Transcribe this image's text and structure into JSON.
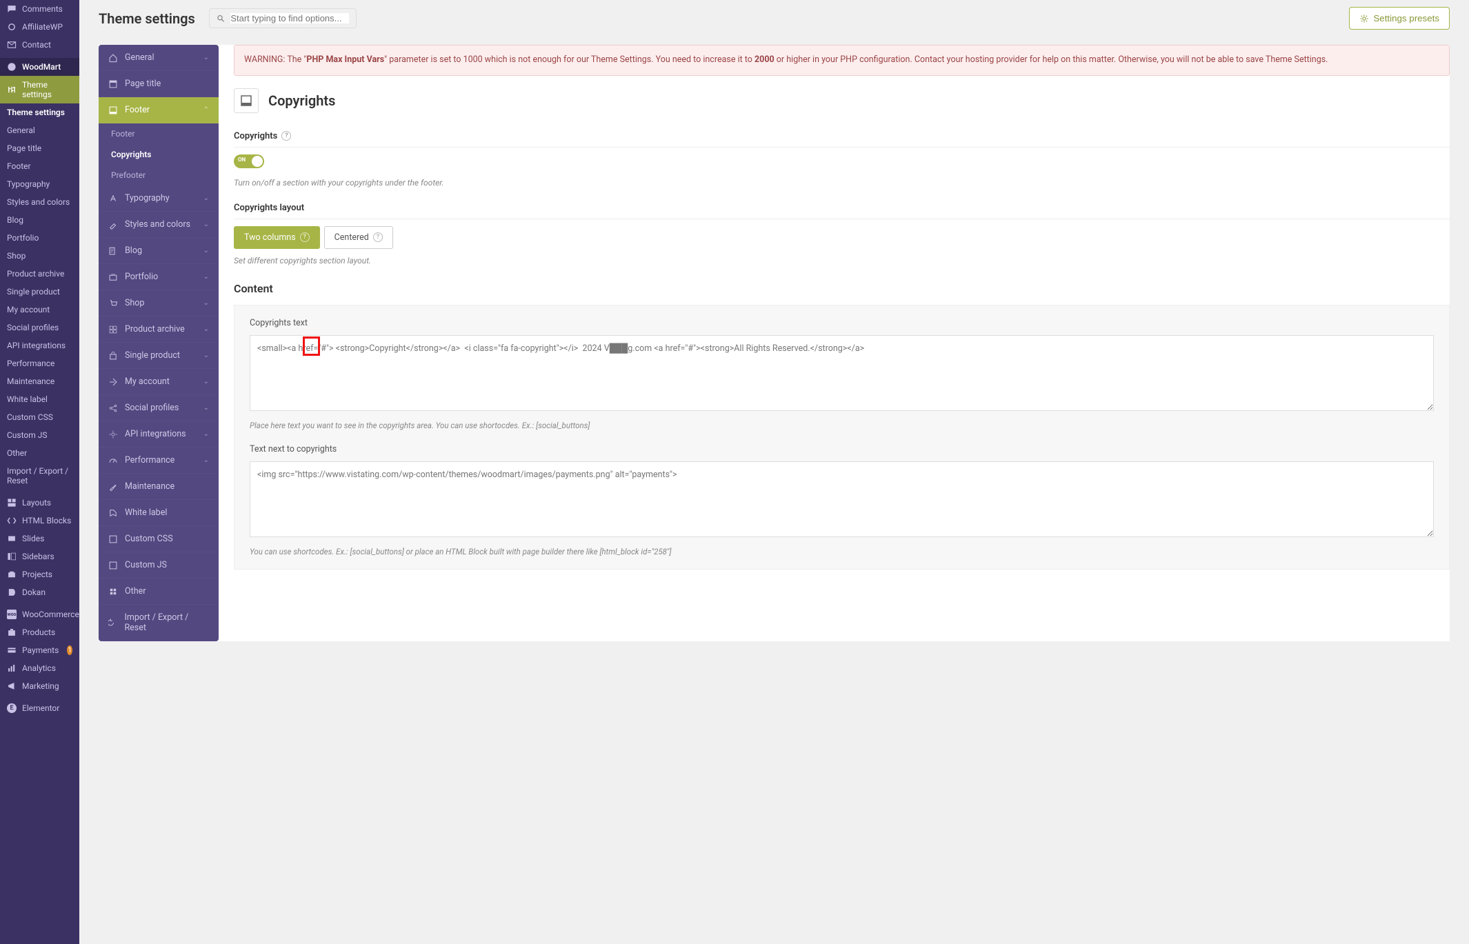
{
  "header": {
    "title": "Theme settings",
    "search_placeholder": "Start typing to find options...",
    "presets_label": "Settings presets"
  },
  "wp_menu": {
    "comments": "Comments",
    "affiliate": "AffiliateWP",
    "contact": "Contact",
    "woodmart": "WoodMart",
    "theme_settings": "Theme settings",
    "subs": {
      "theme_settings": "Theme settings",
      "general": "General",
      "page_title": "Page title",
      "footer": "Footer",
      "typography": "Typography",
      "styles_colors": "Styles and colors",
      "blog": "Blog",
      "portfolio": "Portfolio",
      "shop": "Shop",
      "product_archive": "Product archive",
      "single_product": "Single product",
      "my_account": "My account",
      "social_profiles": "Social profiles",
      "api_integrations": "API integrations",
      "performance": "Performance",
      "maintenance": "Maintenance",
      "white_label": "White label",
      "custom_css": "Custom CSS",
      "custom_js": "Custom JS",
      "other": "Other",
      "import_export": "Import / Export / Reset"
    },
    "layouts": "Layouts",
    "html_blocks": "HTML Blocks",
    "slides": "Slides",
    "sidebars": "Sidebars",
    "projects": "Projects",
    "dokan": "Dokan",
    "woo": "WooCommerce",
    "products": "Products",
    "payments": "Payments",
    "payments_badge": "1",
    "analytics": "Analytics",
    "marketing": "Marketing",
    "elementor": "Elementor"
  },
  "settings_nav": {
    "general": "General",
    "page_title": "Page title",
    "footer": "Footer",
    "footer_sub": "Footer",
    "copyrights_sub": "Copyrights",
    "prefooter_sub": "Prefooter",
    "typography": "Typography",
    "styles_colors": "Styles and colors",
    "blog": "Blog",
    "portfolio": "Portfolio",
    "shop": "Shop",
    "product_archive": "Product archive",
    "single_product": "Single product",
    "my_account": "My account",
    "social_profiles": "Social profiles",
    "api_integrations": "API integrations",
    "performance": "Performance",
    "maintenance": "Maintenance",
    "white_label": "White label",
    "custom_css": "Custom CSS",
    "custom_js": "Custom JS",
    "other": "Other",
    "import_export": "Import / Export / Reset"
  },
  "warning": {
    "prefix": "WARNING: The \"",
    "var": "PHP Max Input Vars",
    "mid": "\" parameter is set to 1000 which is not enough for our Theme Settings. You need to increase it to ",
    "num": "2000",
    "suffix": " or higher in your PHP configuration. Contact your hosting provider for help on this matter. Otherwise, you will not be able to save Theme Settings."
  },
  "panel": {
    "section_title": "Copyrights",
    "copyrights_label": "Copyrights",
    "toggle_text": "ON",
    "copyrights_desc": "Turn on/off a section with your copyrights under the footer.",
    "layout_label": "Copyrights layout",
    "two_columns": "Two columns",
    "centered": "Centered",
    "layout_desc": "Set different copyrights section layout.",
    "content_heading": "Content",
    "copyrights_text_label": "Copyrights text",
    "copyrights_text_value": "<small><a href=\"#\"> <strong>Copyright</strong></a>  <i class=\"fa fa-copyright\"></i>  2024 V███g.com <a href=\"#\"><strong>All Rights Reserved.</strong></a>",
    "copyrights_text_hint": "Place here text you want to see in the copyrights area. You can use shortocdes. Ex.: [social_buttons]",
    "text_next_label": "Text next to copyrights",
    "text_next_value": "<img src=\"https://www.vistating.com/wp-content/themes/woodmart/images/payments.png\" alt=\"payments\">",
    "text_next_hint": "You can use shortcodes. Ex.: [social_buttons] or place an HTML Block built with page builder there like [html_block id=\"258\"]"
  }
}
